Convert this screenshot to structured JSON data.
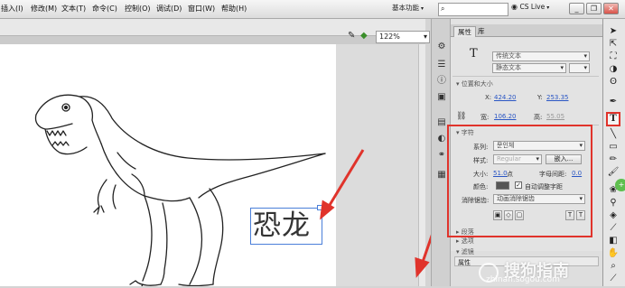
{
  "menubar": {
    "items": [
      "插入(I)",
      "修改(M)",
      "文本(T)",
      "命令(C)",
      "控制(O)",
      "调试(D)",
      "窗口(W)",
      "帮助(H)"
    ],
    "workspace": "基本功能",
    "cslive": "CS Live"
  },
  "stage": {
    "zoom": "122%",
    "text_object": "恐龙"
  },
  "properties": {
    "tabs": [
      "属性",
      "库"
    ],
    "text_engine": "传统文本",
    "text_type": "静态文本",
    "position_section": "位置和大小",
    "x_label": "X:",
    "x_value": "424.20",
    "y_label": "Y:",
    "y_value": "253.35",
    "w_label": "宽:",
    "w_value": "106.20",
    "h_label": "高:",
    "h_value": "55.05",
    "char_section": "字符",
    "family_label": "系列:",
    "family_value": "문인체",
    "style_label": "样式:",
    "style_value": "Regular",
    "embed_button": "嵌入...",
    "size_label": "大小:",
    "size_value": "51.0",
    "size_unit": "点",
    "spacing_label": "字母间距:",
    "spacing_value": "0.0",
    "color_label": "颜色:",
    "auto_kern_label": "自动调整字距",
    "anti_alias_label": "消除锯齿:",
    "anti_alias_value": "动画消除锯齿",
    "para_section": "段落",
    "options_section": "选项",
    "filters_section": "滤镜",
    "filters_column": "属性"
  },
  "watermark": {
    "main": "搜狗指南",
    "url": "zhinan.sogou.com"
  },
  "colors": {
    "highlight": "#e0332b",
    "link": "#2a56c4",
    "selection": "#4a7fd9"
  }
}
